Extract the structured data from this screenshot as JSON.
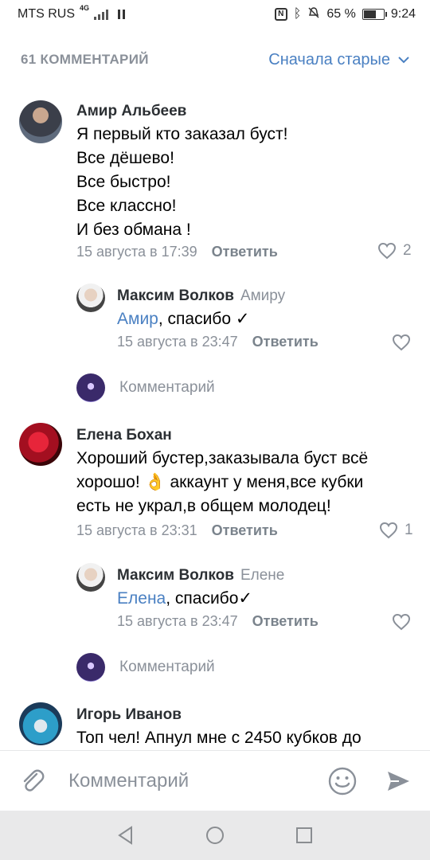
{
  "status": {
    "carrier": "MTS RUS",
    "network": "4G",
    "battery_percent_label": "65 %",
    "battery_level": 0.65,
    "time": "9:24"
  },
  "header": {
    "count_label": "61 КОММЕНТАРИЙ",
    "sort_label": "Сначала старые"
  },
  "comments": [
    {
      "author": "Амир Альбеев",
      "lines": [
        "Я первый кто заказал буст!",
        "Все дёшево!",
        "Все быстро!",
        "Все классно!",
        "И без обмана !"
      ],
      "date": "15 августа в 17:39",
      "reply_label": "Ответить",
      "likes": "2",
      "replies": [
        {
          "author": "Максим Волков",
          "to": "Амиру",
          "mention": "Амир",
          "text": ", спасибо ✓",
          "date": "15 августа в 23:47",
          "reply_label": "Ответить"
        }
      ],
      "reply_placeholder": "Комментарий"
    },
    {
      "author": "Елена Бохан",
      "lines": [
        "Хороший бустер,заказывала буст всё",
        "хорошо! 👌 аккаунт у меня,все кубки",
        "есть не украл,в общем молодец!"
      ],
      "date": "15 августа в 23:31",
      "reply_label": "Ответить",
      "likes": "1",
      "replies": [
        {
          "author": "Максим Волков",
          "to": "Елене",
          "mention": "Елена",
          "text": ", спасибо✓",
          "date": "15 августа в 23:47",
          "reply_label": "Ответить"
        }
      ],
      "reply_placeholder": "Комментарий"
    },
    {
      "author": "Игорь Иванов",
      "lines": [
        "Топ чел! Апнул мне с 2450 кубков до"
      ]
    }
  ],
  "input": {
    "placeholder": "Комментарий"
  },
  "colors": {
    "accent": "#4a80c2",
    "muted": "#8a9099"
  }
}
